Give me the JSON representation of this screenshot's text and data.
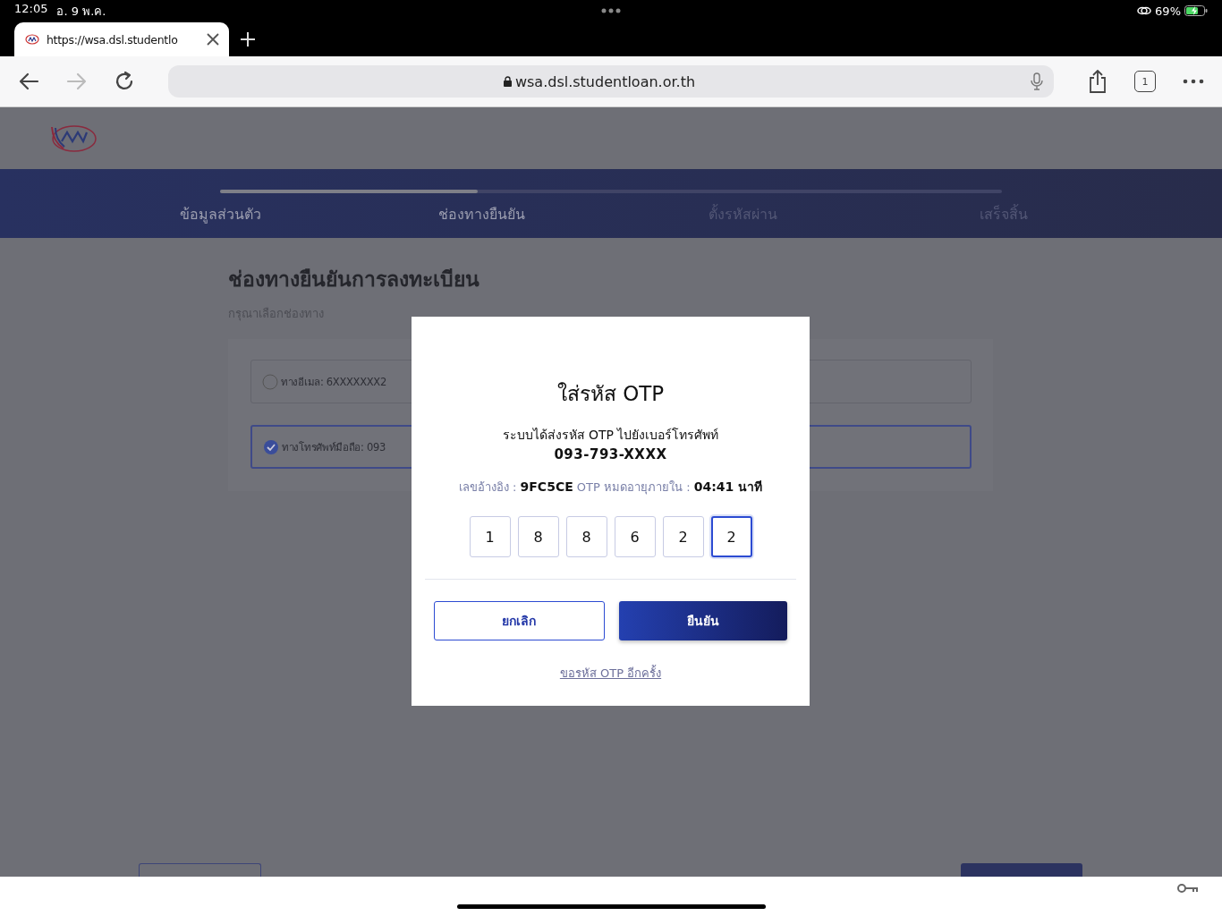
{
  "status_bar": {
    "time": "12:05",
    "date": "อ. 9 พ.ค.",
    "battery": "69%"
  },
  "browser": {
    "tab_title": "https://wsa.dsl.studentlo",
    "address": "wsa.dsl.studentloan.or.th",
    "tab_count": "1"
  },
  "steps": {
    "level": 0.33,
    "items": [
      {
        "label": "ข้อมูลส่วนตัว",
        "completed": true
      },
      {
        "label": "ช่องทางยืนยัน",
        "completed": true
      },
      {
        "label": "ตั้งรหัสผ่าน",
        "completed": false
      },
      {
        "label": "เสร็จสิ้น",
        "completed": false
      }
    ]
  },
  "page": {
    "title": "ช่องทางยืนยันการลงทะเบียน",
    "subtitle": "กรุณาเลือกช่องทาง",
    "options": [
      {
        "label": "ทางอีเมล: 6XXXXXXX2",
        "selected": false
      },
      {
        "label": "ทางโทรศัพท์มือถือ: 093",
        "selected": true
      }
    ]
  },
  "modal": {
    "title": "ใส่รหัส OTP",
    "message": "ระบบได้ส่งรหัส OTP ไปยังเบอร์โทรศัพท์",
    "phone": "093-793-XXXX",
    "reference": "เลขอ้างอิง : **9FC5CE** OTP หมดอายุภายใน : **04:41 นาที**",
    "otp": [
      {
        "digit": "1",
        "selected": false
      },
      {
        "digit": "8",
        "selected": false
      },
      {
        "digit": "8",
        "selected": false
      },
      {
        "digit": "6",
        "selected": false
      },
      {
        "digit": "2",
        "selected": false
      },
      {
        "digit": "2",
        "selected": true
      }
    ],
    "buttons": [
      {
        "label": "ยกเลิก",
        "kind": "outline"
      },
      {
        "label": "ยืนยัน",
        "kind": "primary"
      }
    ],
    "resend": "ขอรหัส OTP อีกครั้ง"
  }
}
